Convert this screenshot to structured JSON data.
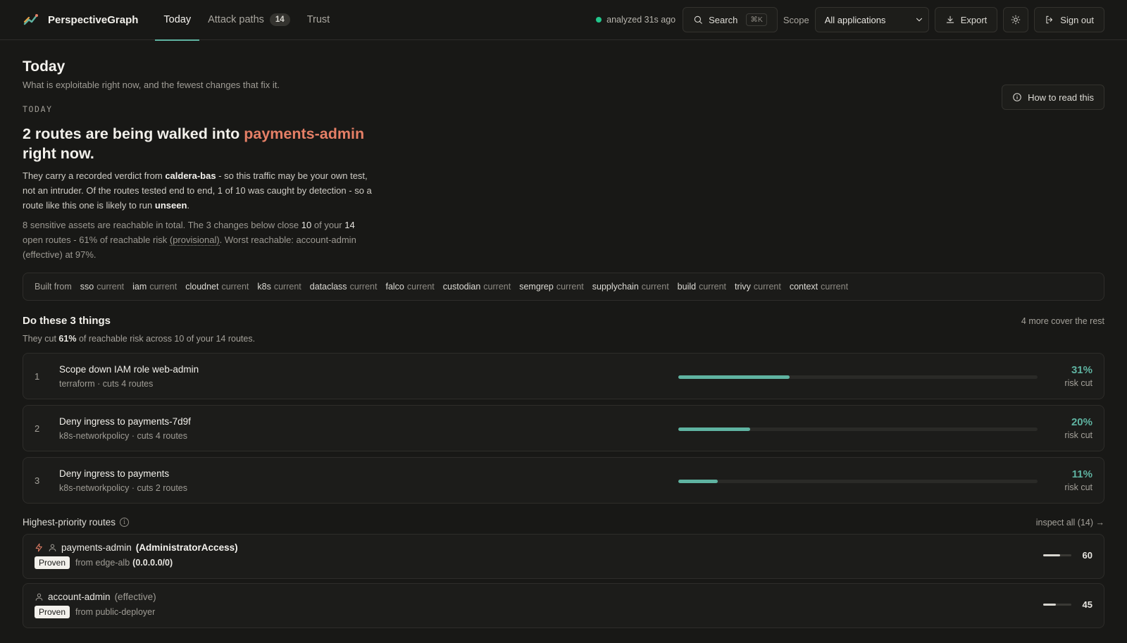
{
  "app": {
    "name": "PerspectiveGraph"
  },
  "nav": [
    {
      "label": "Today",
      "active": true
    },
    {
      "label": "Attack paths",
      "badge": "14"
    },
    {
      "label": "Trust"
    }
  ],
  "toolbar": {
    "status": "analyzed 31s ago",
    "search_label": "Search",
    "search_shortcut": "⌘K",
    "scope_label": "Scope",
    "scope_value": "All applications",
    "export_label": "Export",
    "signout_label": "Sign out"
  },
  "header": {
    "title": "Today",
    "subtitle": "What is exploitable right now, and the fewest changes that fix it.",
    "help_label": "How to read this"
  },
  "briefing": {
    "eyebrow": "TODAY",
    "headline_pre": "2 routes are being walked into",
    "headline_target": "payments-admin",
    "headline_post": "right now.",
    "p1_a": "They carry a recorded verdict from",
    "p1_source": "caldera-bas",
    "p1_b": "- so this traffic may be your own test, not an intruder. Of the routes tested end to end, 1 of 10 was caught by detection - so a route like this one is likely to run",
    "p1_unseen": "unseen",
    "p1_end": ".",
    "p2_a": "8 sensitive assets are reachable in total. The 3 changes below close",
    "p2_closed": "10",
    "p2_b": "of your",
    "p2_total": "14",
    "p2_c": "open routes - 61% of reachable risk",
    "p2_prov": "(provisional)",
    "p2_d": ". Worst reachable: account-admin (effective) at 97%."
  },
  "sources": {
    "label": "Built from",
    "items": [
      {
        "name": "sso",
        "state": "current"
      },
      {
        "name": "iam",
        "state": "current"
      },
      {
        "name": "cloudnet",
        "state": "current"
      },
      {
        "name": "k8s",
        "state": "current"
      },
      {
        "name": "dataclass",
        "state": "current"
      },
      {
        "name": "falco",
        "state": "current"
      },
      {
        "name": "custodian",
        "state": "current"
      },
      {
        "name": "semgrep",
        "state": "current"
      },
      {
        "name": "supplychain",
        "state": "current"
      },
      {
        "name": "build",
        "state": "current"
      },
      {
        "name": "trivy",
        "state": "current"
      },
      {
        "name": "context",
        "state": "current"
      }
    ]
  },
  "actions_section": {
    "title": "Do these 3 things",
    "aside": "4 more cover the rest",
    "sub_a": "They cut",
    "sub_pct": "61%",
    "sub_b": "of reachable risk across 10 of your 14 routes.",
    "items": [
      {
        "num": "1",
        "title": "Scope down IAM role web-admin",
        "sub": "terraform · cuts 4 routes",
        "pct": "31%",
        "fill": 0.31,
        "pct_label": "risk cut"
      },
      {
        "num": "2",
        "title": "Deny ingress to payments-7d9f",
        "sub": "k8s-networkpolicy · cuts 4 routes",
        "pct": "20%",
        "fill": 0.2,
        "pct_label": "risk cut"
      },
      {
        "num": "3",
        "title": "Deny ingress to payments",
        "sub": "k8s-networkpolicy · cuts 2 routes",
        "pct": "11%",
        "fill": 0.11,
        "pct_label": "risk cut"
      }
    ]
  },
  "routes_section": {
    "title": "Highest-priority routes",
    "info_glyph": "i",
    "link": "inspect all (14) →",
    "items": [
      {
        "target": "payments-admin",
        "qualifier": "(AdministratorAccess)",
        "badge": "Proven",
        "from_prefix": "from edge-alb",
        "from_detail": "(0.0.0.0/0)",
        "score": "60",
        "score_fill": 0.6,
        "exploited": true
      },
      {
        "target": "account-admin",
        "qualifier": "(effective)",
        "badge": "Proven",
        "from_prefix": "from public-deployer",
        "from_detail": "",
        "score": "45",
        "score_fill": 0.45,
        "exploited": false
      }
    ]
  },
  "colors": {
    "accent": "#5fb3a1",
    "alert": "#e57f66",
    "status_ok": "#22c58b",
    "background": "#181816"
  }
}
